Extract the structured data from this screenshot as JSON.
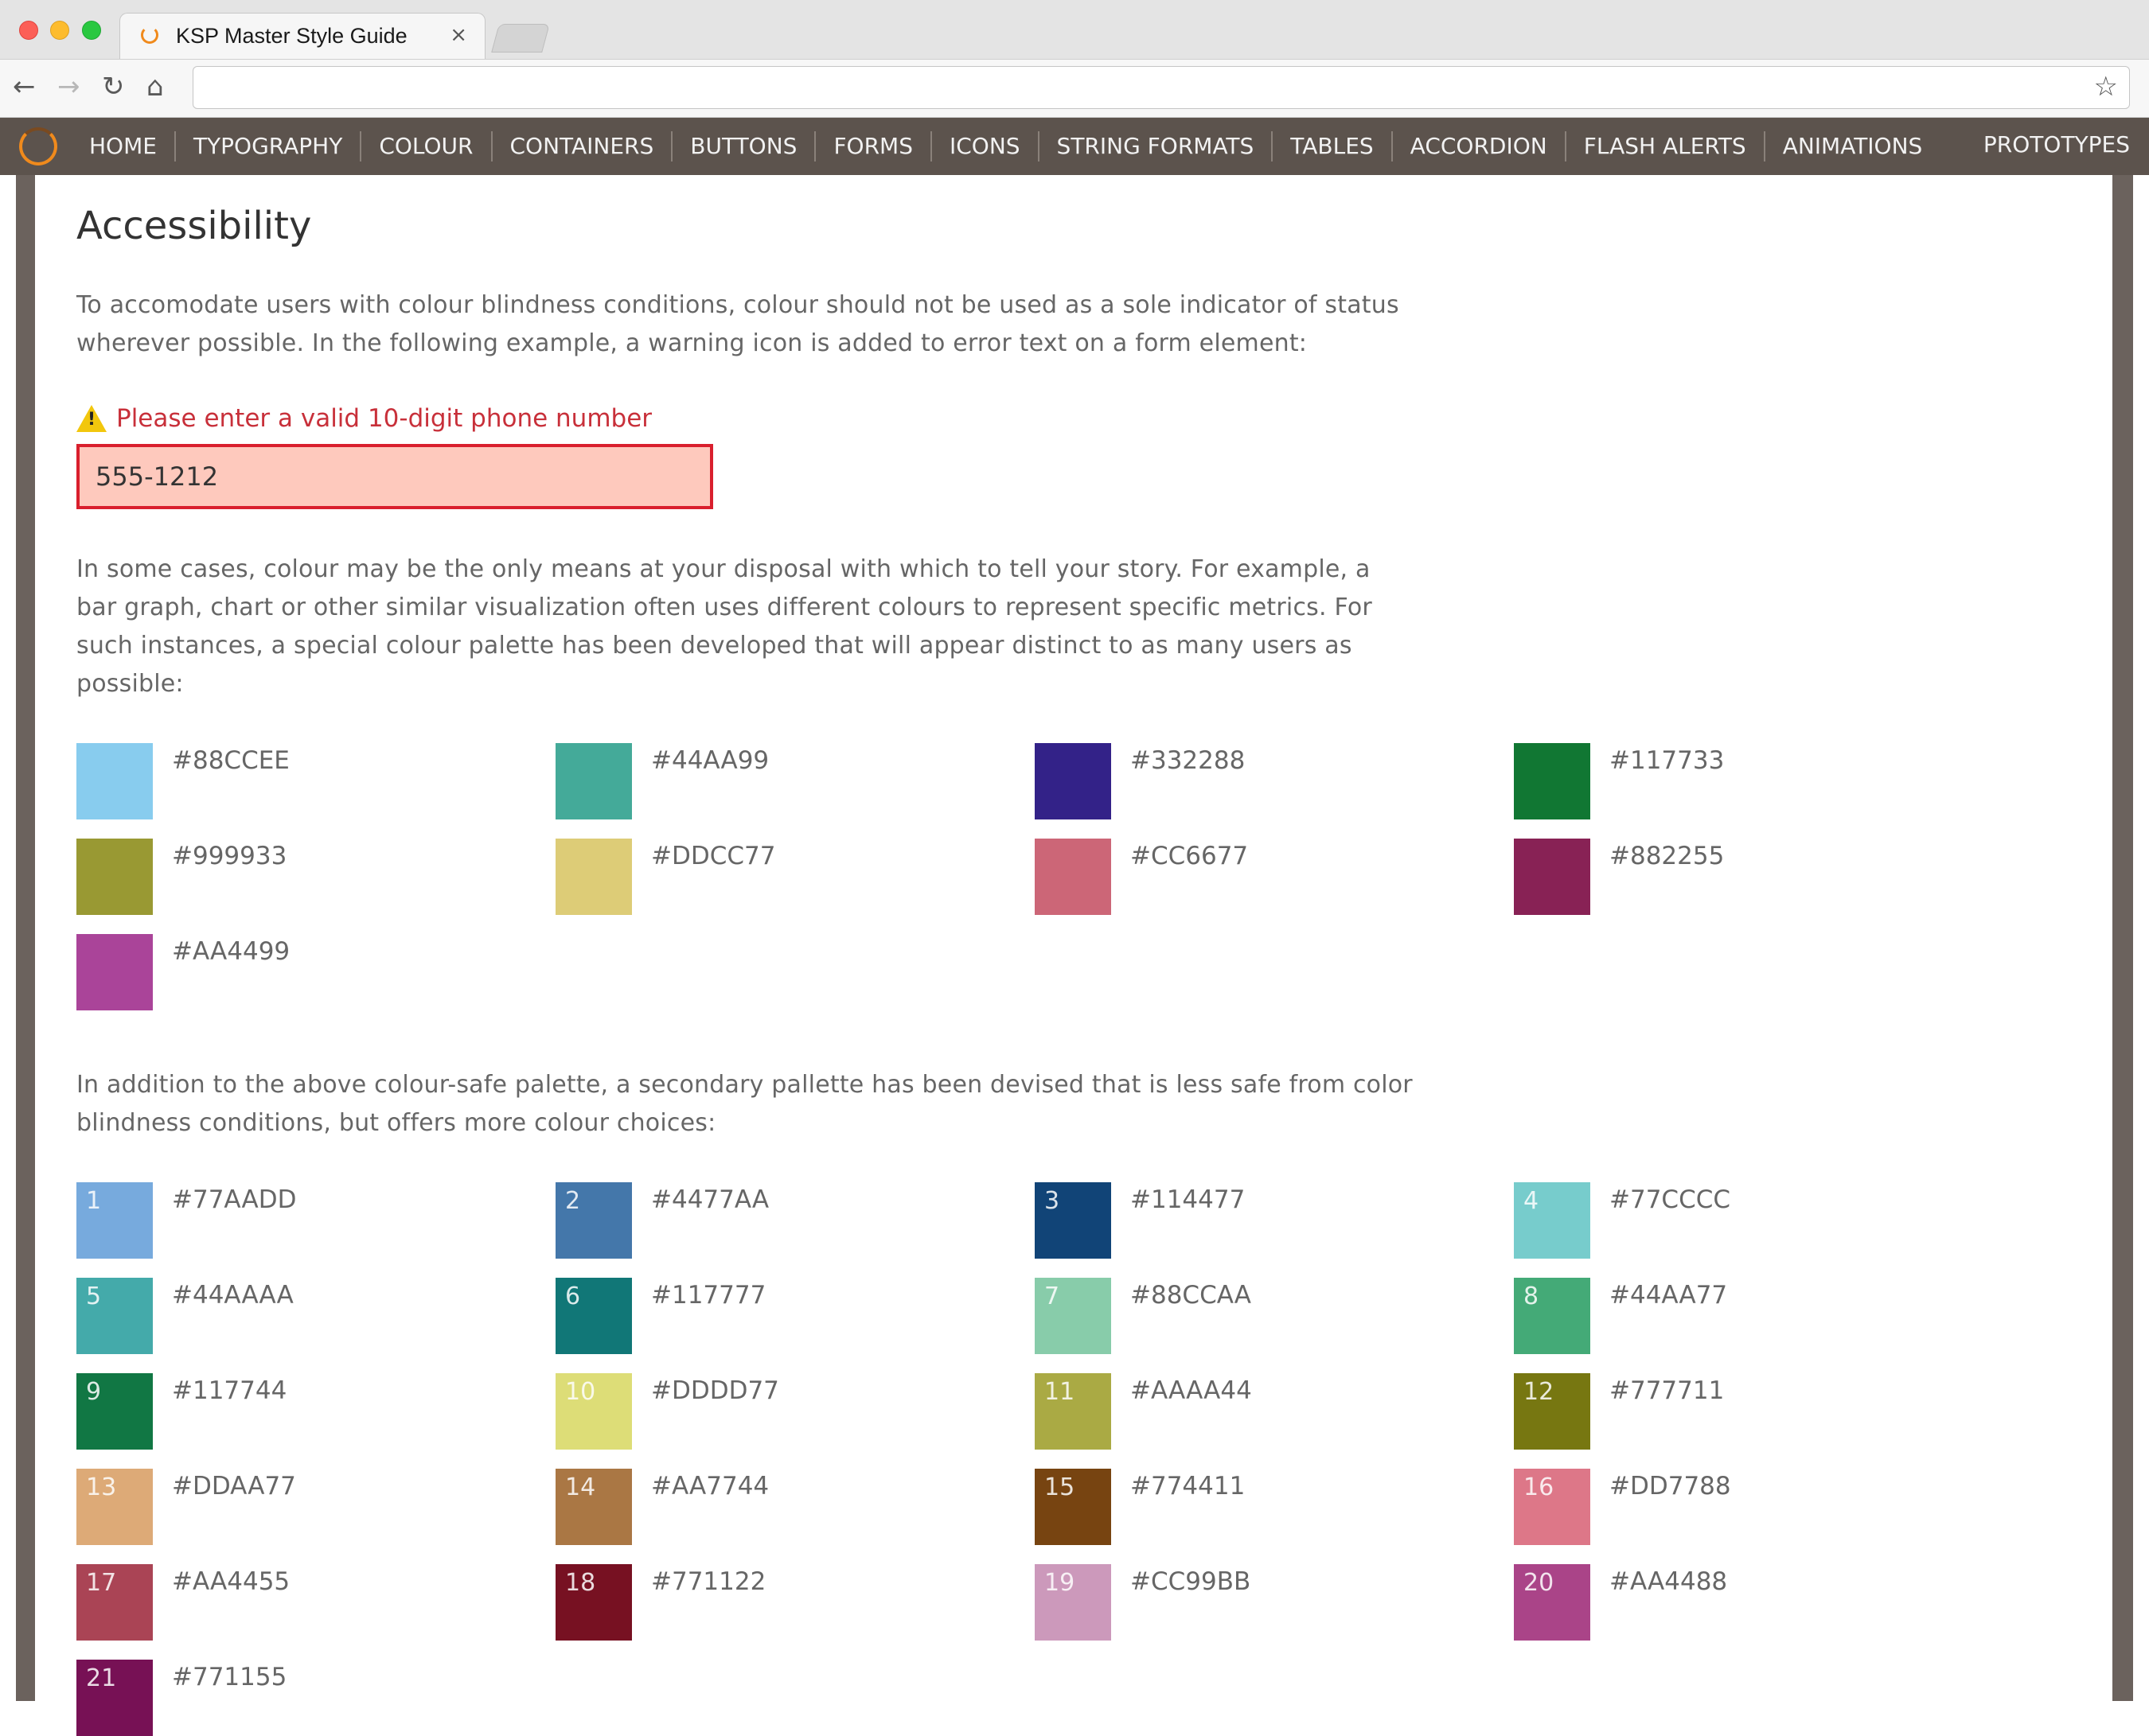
{
  "browser": {
    "tab_title": "KSP Master Style Guide",
    "close_glyph": "×",
    "star_glyph": "☆",
    "url": ""
  },
  "nav": {
    "items": [
      "HOME",
      "TYPOGRAPHY",
      "COLOUR",
      "CONTAINERS",
      "BUTTONS",
      "FORMS",
      "ICONS",
      "STRING FORMATS",
      "TABLES",
      "ACCORDION",
      "FLASH ALERTS",
      "ANIMATIONS"
    ],
    "right_item": "PROTOTYPES"
  },
  "page": {
    "title": "Accessibility",
    "intro": "To accomodate users with colour blindness conditions, colour should not be used as a sole indicator of status wherever possible. In the following example, a warning icon is added to error text on a form element:",
    "error_message": "Please enter a valid 10-digit phone number",
    "phone_value": "555-1212",
    "para2": "In some cases, colour may be the only means at your disposal with which to tell your story. For example, a bar graph, chart or other similar visualization often uses different colours to represent specific metrics. For such instances, a special colour palette has been developed that will appear distinct to as many users as possible:",
    "para3": "In addition to the above colour-safe palette, a secondary pallette has been devised that is less safe from color blindness conditions, but offers more colour choices:"
  },
  "palette_safe": [
    {
      "hex": "#88CCEE",
      "color": "#88CCEE"
    },
    {
      "hex": "#44AA99",
      "color": "#44AA99"
    },
    {
      "hex": "#332288",
      "color": "#332288"
    },
    {
      "hex": "#117733",
      "color": "#117733"
    },
    {
      "hex": "#999933",
      "color": "#999933"
    },
    {
      "hex": "#DDCC77",
      "color": "#DDCC77"
    },
    {
      "hex": "#CC6677",
      "color": "#CC6677"
    },
    {
      "hex": "#882255",
      "color": "#882255"
    },
    {
      "hex": "#AA4499",
      "color": "#AA4499"
    }
  ],
  "palette_secondary": [
    {
      "num": "1",
      "hex": "#77AADD",
      "color": "#77AADD"
    },
    {
      "num": "2",
      "hex": "#4477AA",
      "color": "#4477AA"
    },
    {
      "num": "3",
      "hex": "#114477",
      "color": "#114477"
    },
    {
      "num": "4",
      "hex": "#77CCCC",
      "color": "#77CCCC"
    },
    {
      "num": "5",
      "hex": "#44AAAA",
      "color": "#44AAAA"
    },
    {
      "num": "6",
      "hex": "#117777",
      "color": "#117777"
    },
    {
      "num": "7",
      "hex": "#88CCAA",
      "color": "#88CCAA"
    },
    {
      "num": "8",
      "hex": "#44AA77",
      "color": "#44AA77"
    },
    {
      "num": "9",
      "hex": "#117744",
      "color": "#117744"
    },
    {
      "num": "10",
      "hex": "#DDDD77",
      "color": "#DDDD77"
    },
    {
      "num": "11",
      "hex": "#AAAA44",
      "color": "#AAAA44"
    },
    {
      "num": "12",
      "hex": "#777711",
      "color": "#777711"
    },
    {
      "num": "13",
      "hex": "#DDAA77",
      "color": "#DDAA77"
    },
    {
      "num": "14",
      "hex": "#AA7744",
      "color": "#AA7744"
    },
    {
      "num": "15",
      "hex": "#774411",
      "color": "#774411"
    },
    {
      "num": "16",
      "hex": "#DD7788",
      "color": "#DD7788"
    },
    {
      "num": "17",
      "hex": "#AA4455",
      "color": "#AA4455"
    },
    {
      "num": "18",
      "hex": "#771122",
      "color": "#771122"
    },
    {
      "num": "19",
      "hex": "#CC99BB",
      "color": "#CC99BB"
    },
    {
      "num": "20",
      "hex": "#AA4488",
      "color": "#AA4488"
    },
    {
      "num": "21",
      "hex": "#771155",
      "color": "#771155"
    }
  ],
  "colors": {
    "nav_bg": "#5c534d",
    "accent": "#f08a1c",
    "error": "#c8303a",
    "error_input_bg": "#fec9bd"
  },
  "icons": {
    "back": "back-arrow-icon",
    "forward": "forward-arrow-icon",
    "reload": "reload-icon",
    "home": "home-icon",
    "star": "bookmark-star-icon",
    "warning": "warning-icon",
    "logo": "site-logo-icon"
  }
}
